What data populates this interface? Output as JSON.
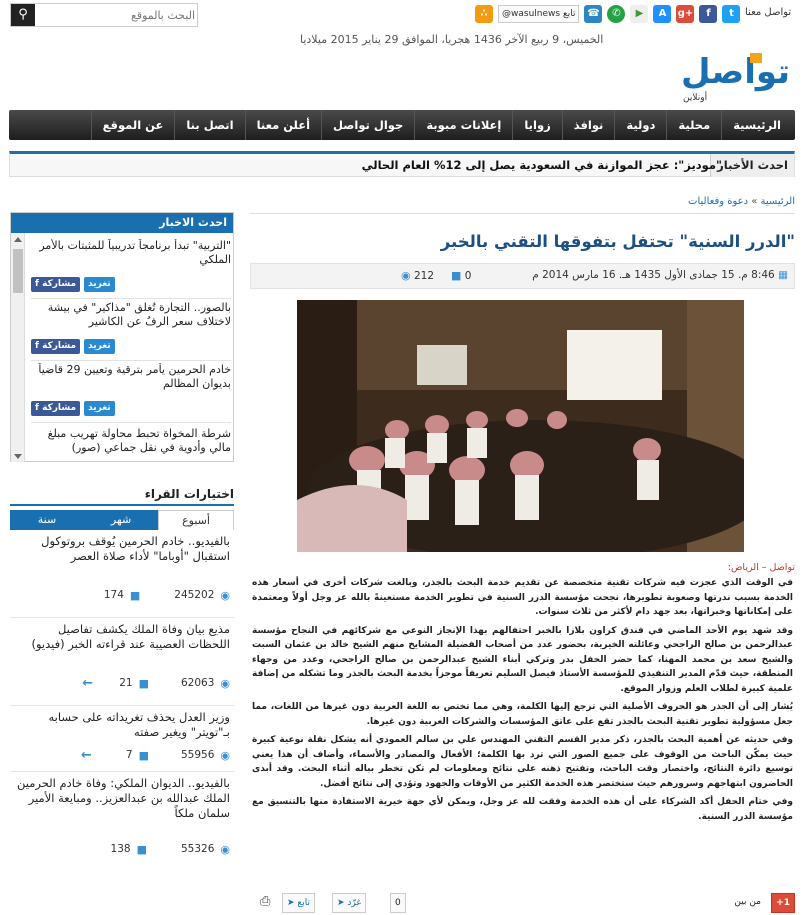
{
  "search": {
    "placeholder": "البحث بالموقع",
    "button_icon": "search-icon"
  },
  "header": {
    "contact_label": "تواصل معنا",
    "follow_label": "تابع",
    "twitter_handle": "@wasulnews",
    "date_line": "الخميس، 9 ربيع الآخر 1436 هجريا، الموافق 29 يناير 2015 ميلاديا",
    "social_icons": [
      "twitter-icon",
      "facebook-icon",
      "google-plus-icon",
      "app-store-icon",
      "google-play-icon",
      "whatsapp-icon",
      "phone-icon",
      "rss-icon"
    ],
    "logo_text": "تواصل",
    "logo_sub": "أونلاين"
  },
  "nav": {
    "items": [
      "الرئيسية",
      "محلية",
      "دولية",
      "نوافذ",
      "زوايا",
      "إعلانات مبوبة",
      "جوال تواصل",
      "أعلن معنا",
      "اتصل بنا",
      "عن الموقع"
    ]
  },
  "breaking": {
    "label": "احدث الأخبار",
    "text": "\"موديز\": عجز الموازنة في السعودية يصل إلى 12% العام الحالي"
  },
  "sidebar_latest": {
    "title": "احدث الاخبار",
    "share_label": "مشاركة",
    "tweet_label": "تغريد",
    "items": [
      {
        "title": "\"التربية\" تبدأ برنامجاً تدريبياً للمثبتات بالأمر الملكي"
      },
      {
        "title": "بالصور.. التجارة تُغلق \"مذاكير\" في بيشة لاختلاف سعر الرفُ عن الكاشير"
      },
      {
        "title": "خادم الحرمين يأمر بترقية وتعيين 29 قاضياً بديوان المظالم"
      },
      {
        "title": "شرطة المخواة تحبط محاولة تهريب مبلغ مالي وأدوية في نقل جماعي (صور)"
      }
    ]
  },
  "readers_picks": {
    "title": "اختيارات القراء",
    "tabs": [
      "سنة",
      "شهر",
      "أسبوع"
    ],
    "items": [
      {
        "title": "بالفيديو.. خادم الحرمين يُوقف بروتوكول استقبال \"أوباما\" لأداء صلاة العصر",
        "views": "245202",
        "comments": "174"
      },
      {
        "title": "مذيع بيان وفاة الملك يكشف تفاصيل اللحظات العصيبة عند قراءته الخبر (فيديو)",
        "views": "62063",
        "comments": "21"
      },
      {
        "title": "وزير العدل يحذف تغريداته على حسابه بـ\"تويتر\" ويغير صفته",
        "views": "55956",
        "comments": "7"
      },
      {
        "title": "بالفيديو.. الديوان الملكي: وفاة خادم الحرمين الملك عبدالله بن عبدالعزيز.. ومبايعة الأمير سلمان ملكاً",
        "views": "55326",
        "comments": "138"
      }
    ]
  },
  "article": {
    "breadcrumb_home": "الرئيسية",
    "breadcrumb_section": "دعوة وفعاليات",
    "title": "\"الدرر السنية\" تحتفل بتفوقها التقني بالخبر",
    "date": "8:46 م. 15 جمادى الأول 1435 هـ. 16 مارس 2014 م",
    "views": "212",
    "comments": "0",
    "byline": "تواصل – الرياض:",
    "paragraphs": [
      "في الوقت الذي عجزت فيه شركات تقنية متخصصة عن تقديم خدمة البحث بالجذر، وبالغت شركات أخرى في أسعار هذه الخدمة بسبب ندرتها وصعوبة تطويرها، نجحت مؤسسة الدرر السنية في تطوير الخدمة مستعينةً بالله عز وجل أولاً ومعتمدة على إمكاناتها وخبراتها، بعد جهد دام لأكثر من ثلاث سنوات.",
      "وقد شهد يوم الأحد الماضي في فندق كراون بلازا بالخبر احتفالهم بهذا الإنجاز النوعي مع شركائهم في النجاح مؤسسة عبدالرحمن بن صالح الراجحي وعائلته الخيرية، بحضور عدد من أصحاب الفضيلة المشايخ منهم الشيخ خالد بن عثمان السبت والشيخ سعد بن محمد المهنا، كما حضر الحفل بدر وتركي أبناء الشيخ عبدالرحمن بن صالح الراجحي، وعدد من وجهاء المنطقة، حيث قدّم المدير التنفيذي للمؤسسة الأستاذ فيصل السليم تعريفاً موجزاً بخدمة البحث بالجذر وما تشكله من إضافة علمية كبيرة لطلاب العلم وزوار الموقع.",
      "يُشار إلى أن الجذر هو الحروف الأصلية التي ترجع إليها الكلمة، وهي مما تختص به اللغة العربية دون غيرها من اللغات، مما جعل مسؤولية تطوير تقنية البحث بالجذر تقع على عاتق المؤسسات والشركات العربية دون غيرها.",
      "وفي حديثه عن أهمية البحث بالجذر، ذكر مدير القسم التقني المهندس علي بن سالم العمودي أنه يشكل نقلة نوعية كبيرة حيث يمكّن الباحث من الوقوف على جميع الصور التي ترد بها الكلمة؛ الأفعال والمصادر والأسماء، وأضاف أن هذا يعني توسيع دائرة النتائج، واختصار وقت الباحث، وتفتيح ذهنه على نتائج ومعلومات لم تكن تخطر بباله أثناء البحث. وقد أبدى الحاضرون ابتهاجهم وسرورهم حيث ستختصر هذه الخدمة الكثير من الأوقات والجهود وتؤدي إلى نتائج أفضل.",
      "وفي ختام الحفل أكد الشركاء على أن هذه الخدمة وفقت لله عز وجل، ويمكن لأي جهة خيرية الاستفادة منها بالتنسيق مع مؤسسة الدرر السنية."
    ],
    "share": {
      "gplus": "+1",
      "between_label": "من بين",
      "tweet_count": "0",
      "tweet_label": "غرّد",
      "follow_label": "تابع"
    }
  },
  "colors": {
    "accent": "#1a6fb0",
    "nav_dark": "#2b2b2b",
    "title_blue": "#1d4f82",
    "byline_red": "#c0392b"
  }
}
